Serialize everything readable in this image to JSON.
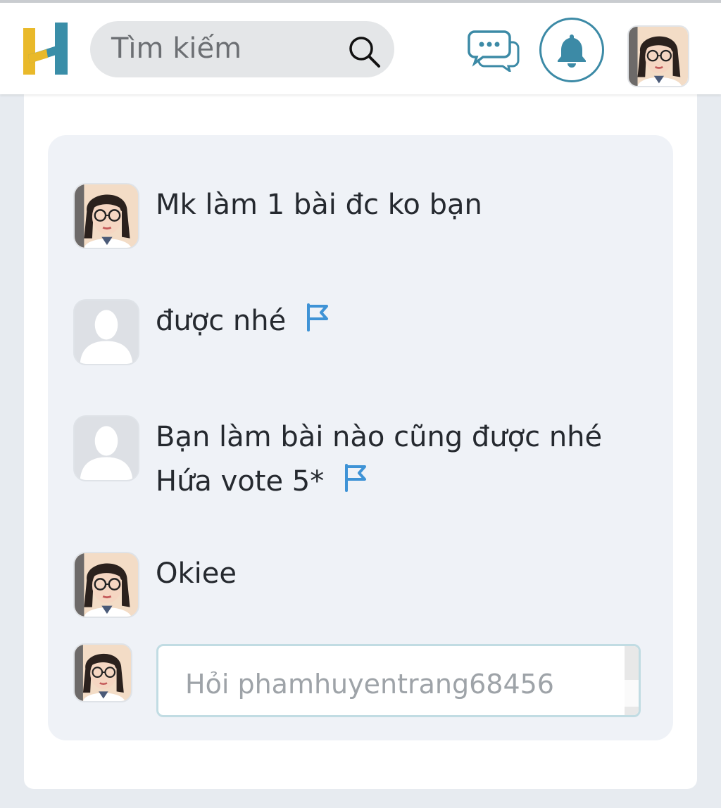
{
  "header": {
    "search_placeholder": "Tìm kiếm",
    "icons": [
      "logo-h",
      "search-icon",
      "chat-icon",
      "bell-icon",
      "avatar"
    ]
  },
  "colors": {
    "logo_yellow": "#e9b92a",
    "logo_teal": "#3a8ea8",
    "accent_teal": "#3c8aa6",
    "flag_blue": "#3f93d6",
    "thread_bg": "#eff2f7"
  },
  "thread": {
    "messages": [
      {
        "author": "user-photo",
        "lines": [
          "Mk làm 1 bài đc ko bạn"
        ],
        "flag": false
      },
      {
        "author": "default",
        "lines": [
          "được nhé"
        ],
        "flag": true
      },
      {
        "author": "default",
        "lines": [
          "Bạn làm bài nào cũng được nhé",
          "Hứa vote 5*"
        ],
        "flag": true
      },
      {
        "author": "user-photo",
        "lines": [
          "Okiee"
        ],
        "flag": false
      }
    ],
    "reply_placeholder": "Hỏi phamhuyentrang68456"
  }
}
